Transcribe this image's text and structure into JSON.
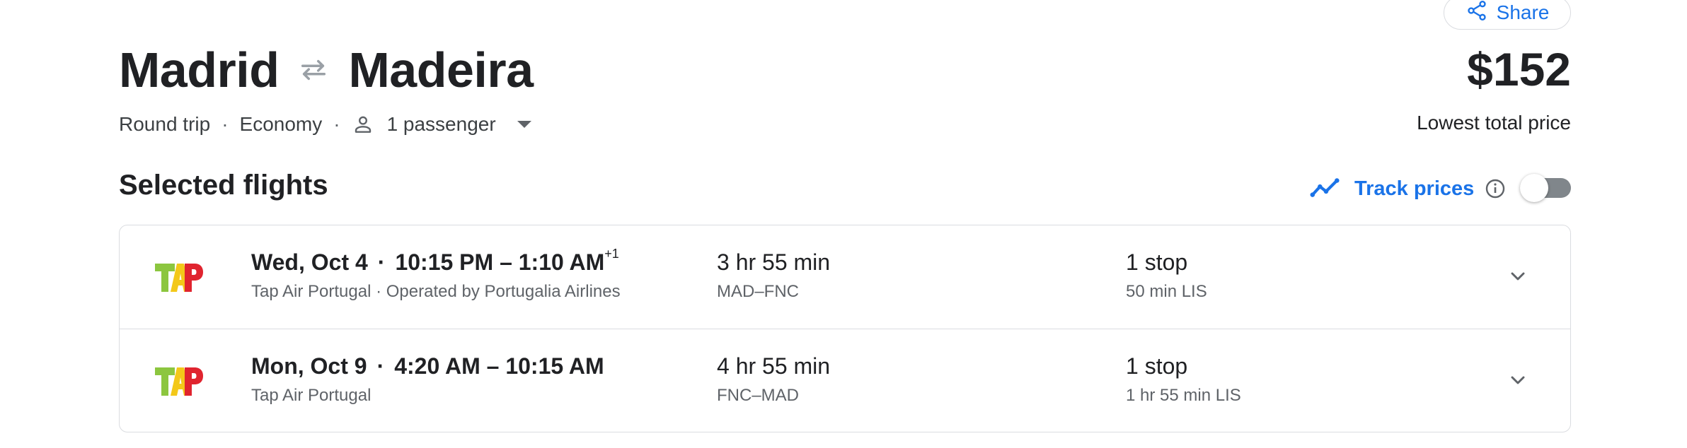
{
  "share": {
    "label": "Share",
    "icon": "share-icon"
  },
  "header": {
    "origin": "Madrid",
    "destination": "Madeira",
    "swap_icon": "swap-arrows-icon",
    "price": "$152",
    "price_caption": "Lowest total price"
  },
  "trip_options": {
    "trip_type": "Round trip",
    "cabin": "Economy",
    "passengers": "1 passenger",
    "sep": "·"
  },
  "selected": {
    "title": "Selected flights",
    "track_label": "Track prices",
    "track_enabled": false
  },
  "flights": [
    {
      "date": "Wed, Oct 4",
      "times": "10:15 PM – 1:10 AM",
      "day_offset": "+1",
      "airline": "Tap Air Portugal · Operated by Portugalia Airlines",
      "duration": "3 hr 55 min",
      "route": "MAD–FNC",
      "stops": "1 stop",
      "layover": "50 min LIS"
    },
    {
      "date": "Mon, Oct 9",
      "times": "4:20 AM – 10:15 AM",
      "day_offset": "",
      "airline": "Tap Air Portugal",
      "duration": "4 hr 55 min",
      "route": "FNC–MAD",
      "stops": "1 stop",
      "layover": "1 hr 55 min LIS"
    }
  ],
  "colors": {
    "accent": "#1a73e8",
    "text": "#202124",
    "secondary": "#5f6368",
    "border": "#dadce0",
    "tap_green": "#8cc63f",
    "tap_red": "#e0242f",
    "tap_yellow": "#f2c200"
  }
}
